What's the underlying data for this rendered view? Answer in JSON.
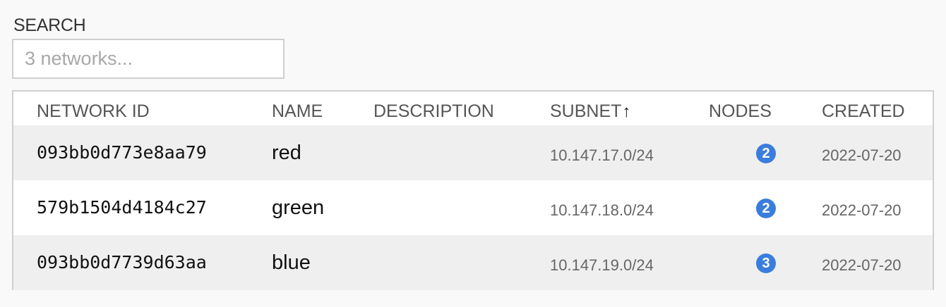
{
  "search": {
    "label": "SEARCH",
    "placeholder": "3 networks...",
    "value": ""
  },
  "table": {
    "columns": {
      "network_id": "NETWORK ID",
      "name": "NAME",
      "description": "DESCRIPTION",
      "subnet": "SUBNET",
      "subnet_sort": "↑",
      "nodes": "NODES",
      "created": "CREATED"
    },
    "rows": [
      {
        "network_id": "093bb0d773e8aa79",
        "name": "red",
        "description": "",
        "subnet": "10.147.17.0/24",
        "nodes": "2",
        "created": "2022-07-20"
      },
      {
        "network_id": "579b1504d4184c27",
        "name": "green",
        "description": "",
        "subnet": "10.147.18.0/24",
        "nodes": "2",
        "created": "2022-07-20"
      },
      {
        "network_id": "093bb0d7739d63aa",
        "name": "blue",
        "description": "",
        "subnet": "10.147.19.0/24",
        "nodes": "3",
        "created": "2022-07-20"
      }
    ]
  },
  "colors": {
    "badge": "#3b7ddd",
    "row_shaded": "#efefef",
    "border": "#cfcfcf"
  }
}
